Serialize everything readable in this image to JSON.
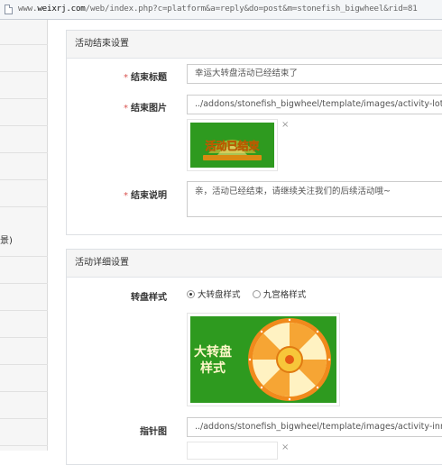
{
  "address_bar": {
    "url_prefix": "www.",
    "url_domain": "weixrj.com",
    "url_rest": "/web/index.php?c=platform&a=reply&do=post&m=stonefish_bigwheel&rid=81"
  },
  "sidebar": {
    "fragment_text": "景)"
  },
  "end_settings": {
    "title": "活动结束设置",
    "end_title_label": "结束标题",
    "end_title_value": "幸运大转盘活动已经结束了",
    "end_image_label": "结束图片",
    "end_image_value": "../addons/stonefish_bigwheel/template/images/activity-lottery-end.png",
    "end_image_text": "活动已结束",
    "end_desc_label": "结束说明",
    "end_desc_value": "亲，活动已经结束，请继续关注我们的后续活动哦~"
  },
  "detail_settings": {
    "title": "活动详细设置",
    "wheel_style_label": "转盘样式",
    "wheel_options": [
      {
        "label": "大转盘样式",
        "selected": true
      },
      {
        "label": "九宫格样式",
        "selected": false
      }
    ],
    "wheel_image_text_line1": "大转盘",
    "wheel_image_text_line2": "样式",
    "pointer_label": "指针图",
    "pointer_value": "../addons/stonefish_bigwheel/template/images/activity-inner.png"
  },
  "close_glyph": "×",
  "colors": {
    "green": "#2e9a1f",
    "required_star": "#d9534f",
    "wheel_orange": "#f08a1c"
  }
}
